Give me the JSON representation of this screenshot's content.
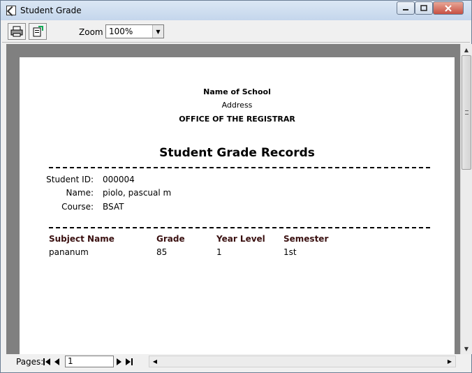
{
  "window": {
    "title": "Student Grade"
  },
  "toolbar": {
    "zoom_label": "Zoom",
    "zoom_value": "100%"
  },
  "report": {
    "school_name": "Name of School",
    "address": "Address",
    "office": "OFFICE OF THE REGISTRAR",
    "title": "Student Grade Records",
    "student_id_label": "Student ID:",
    "student_id": "000004",
    "name_label": "Name:",
    "name": "piolo, pascual m",
    "course_label": "Course:",
    "course": "BSAT",
    "columns": [
      "Subject Name",
      "Grade",
      "Year Level",
      "Semester"
    ],
    "rows": [
      {
        "subject": "pananum",
        "grade": "85",
        "year_level": "1",
        "semester": "1st"
      }
    ]
  },
  "statusbar": {
    "pages_label": "Pages:",
    "page_number": "1"
  },
  "icons": [
    "app-icon",
    "printer-icon",
    "export-icon",
    "dropdown-arrow-icon",
    "first-page-icon",
    "prev-page-icon",
    "next-page-icon",
    "last-page-icon"
  ]
}
